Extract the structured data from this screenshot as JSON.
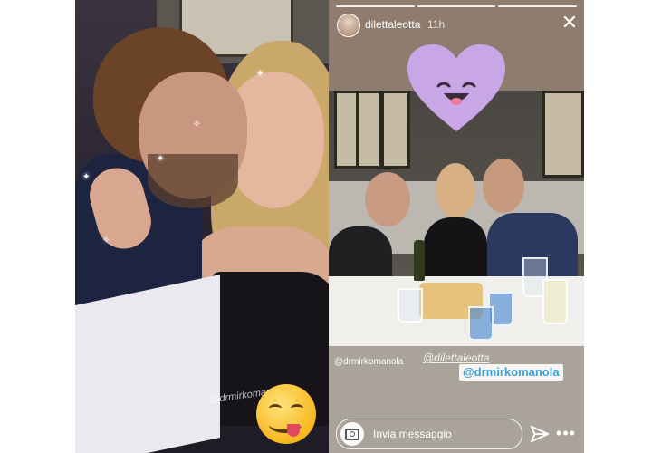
{
  "left_story": {
    "mention_text": "@drmirkomanola",
    "sticker_icon": "tongue-out-face-emoji"
  },
  "right_story": {
    "header": {
      "username": "dilettaleotta",
      "time": "11h",
      "close_icon": "close-icon",
      "progress_segments": 3
    },
    "heart_sticker": "smiling-heart-sticker",
    "mention_small": "@drmirkomanola",
    "mention_handwriting": "@dilettaleotta",
    "mention_badge": "@drmirkomanola",
    "reply": {
      "placeholder": "Invia messaggio",
      "camera_icon": "camera-icon",
      "send_icon": "send-icon",
      "more_icon": "more-dots-icon"
    }
  },
  "colors": {
    "heart": "#c9a7e6",
    "mention_blue": "#3aa1d8"
  }
}
